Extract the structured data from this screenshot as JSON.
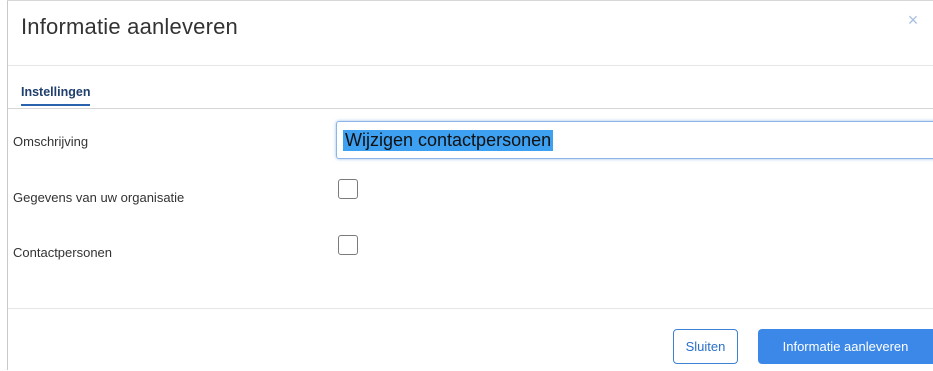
{
  "dialog": {
    "title": "Informatie aanleveren",
    "close_icon": "×"
  },
  "tabs": [
    {
      "label": "Instellingen",
      "active": true
    }
  ],
  "form": {
    "description": {
      "label": "Omschrijving",
      "value": "Wijzigen contactpersonen",
      "selected": true
    },
    "organization_data": {
      "label": "Gegevens van uw organisatie",
      "checked": false
    },
    "contacts": {
      "label": "Contactpersonen",
      "checked": false
    }
  },
  "footer": {
    "close_label": "Sluiten",
    "submit_label": "Informatie aanleveren"
  },
  "colors": {
    "accent": "#3b88e8",
    "tab_underline": "#2a63ad",
    "selection": "#3ea0f0"
  }
}
